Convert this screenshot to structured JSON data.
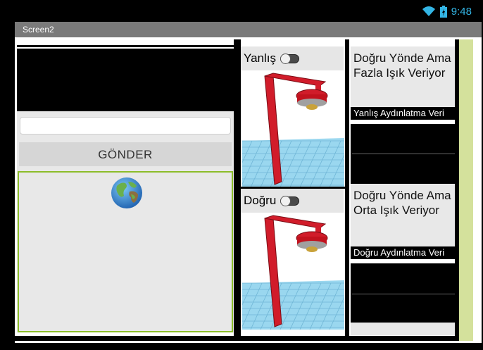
{
  "status_bar": {
    "time": "9:48",
    "icons": [
      "wifi-icon",
      "battery-icon"
    ]
  },
  "screen": {
    "title": "Screen2"
  },
  "form": {
    "input_value": "",
    "send_label": "GÖNDER"
  },
  "lamps": [
    {
      "switch_label": "Yanlış",
      "switch_on": false
    },
    {
      "switch_label": "Doğru",
      "switch_on": false
    }
  ],
  "results": [
    {
      "heading": "Doğru Yönde Ama Fazla Işık Veriyor",
      "data_label": "Yanlış Aydınlatma Veri"
    },
    {
      "heading": "Doğru Yönde Ama Orta Işık Veriyor",
      "data_label": "Doğru Aydınlatma Veri"
    }
  ],
  "colors": {
    "accent": "#33b5e5",
    "title_bar": "#7a7a7a",
    "webview_border": "#8cbd2a",
    "side_strip": "#d4e19c",
    "lamp_red": "#d11c2a",
    "grid_blue": "#9ad7ef"
  }
}
